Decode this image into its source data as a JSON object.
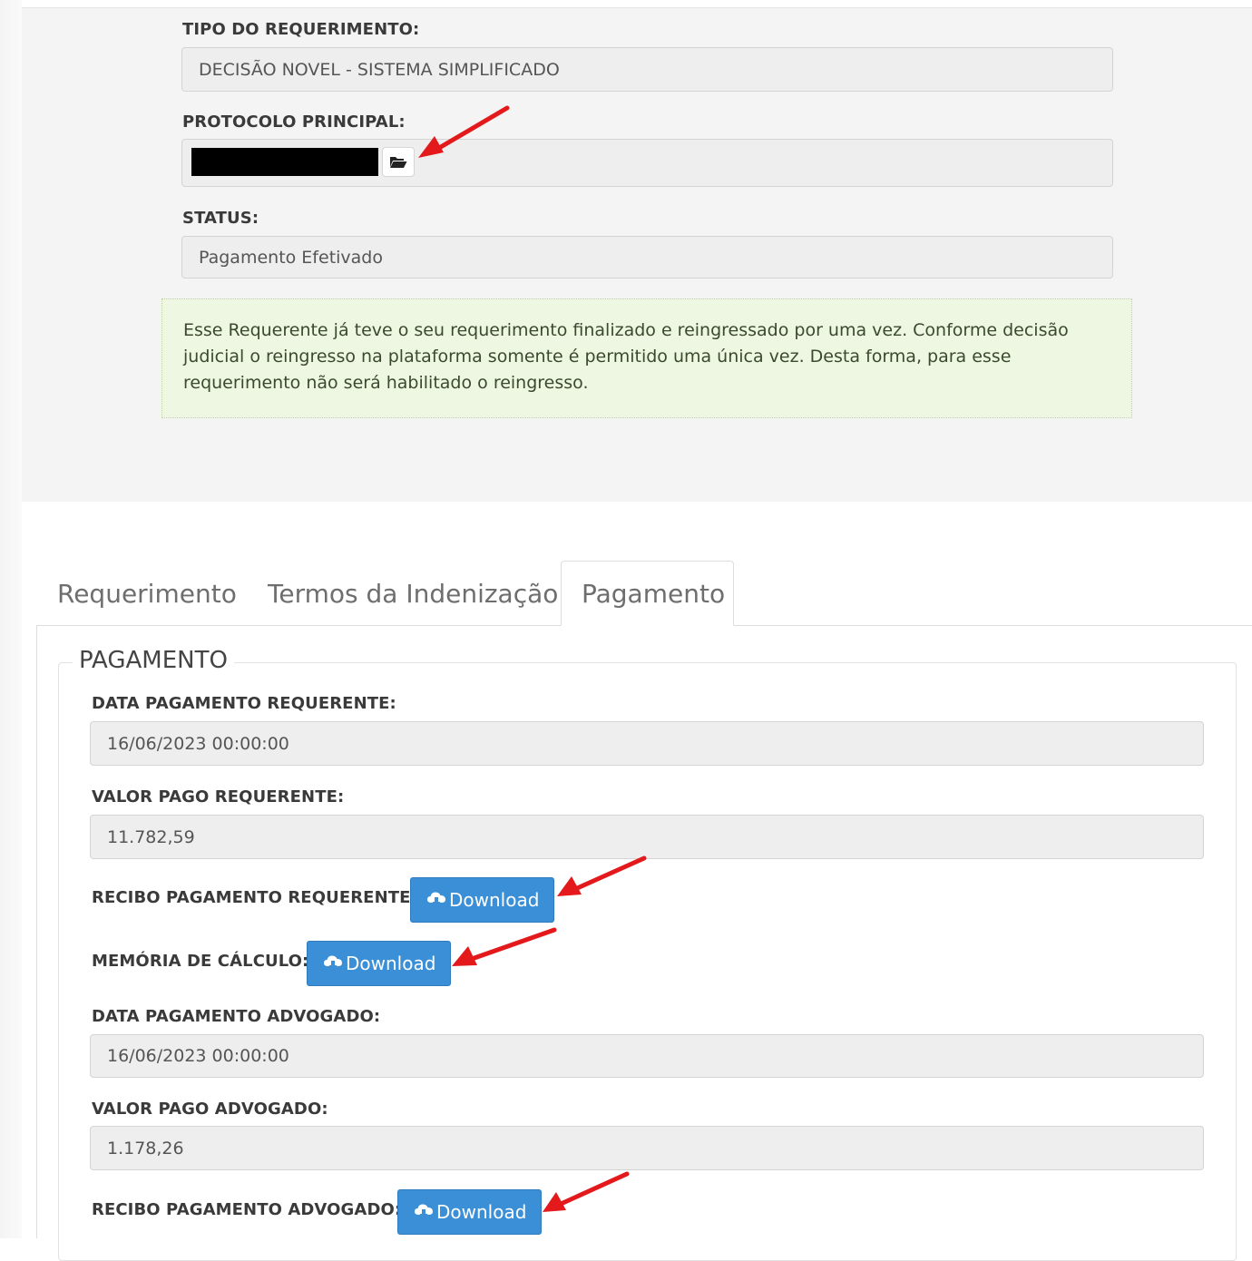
{
  "requerimento": {
    "tipo_label": "TIPO DO REQUERIMENTO:",
    "tipo_value": "DECISÃO NOVEL - SISTEMA SIMPLIFICADO",
    "protocolo_label": "PROTOCOLO PRINCIPAL:",
    "status_label": "STATUS:",
    "status_value": "Pagamento Efetivado",
    "alert_text": "Esse Requerente já teve o seu requerimento finalizado e reingressado por uma vez. Conforme decisão judicial o reingresso na plataforma somente é permitido uma única vez. Desta forma, para esse requerimento não será habilitado o reingresso."
  },
  "tabs": [
    {
      "label": "Requerimento",
      "active": false
    },
    {
      "label": "Termos da Indenização",
      "active": false
    },
    {
      "label": "Pagamento",
      "active": true
    }
  ],
  "pagamento": {
    "legend": "PAGAMENTO",
    "data_requerente_label": "DATA PAGAMENTO REQUERENTE:",
    "data_requerente_value": "16/06/2023 00:00:00",
    "valor_requerente_label": "VALOR PAGO REQUERENTE:",
    "valor_requerente_value": "11.782,59",
    "recibo_requerente_label": "RECIBO PAGAMENTO REQUERENTE:",
    "memoria_label": "MEMÓRIA DE CÁLCULO:",
    "data_advogado_label": "DATA PAGAMENTO ADVOGADO:",
    "data_advogado_value": "16/06/2023 00:00:00",
    "valor_advogado_label": "VALOR PAGO ADVOGADO:",
    "valor_advogado_value": "1.178,26",
    "recibo_advogado_label": "RECIBO PAGAMENTO ADVOGADO:",
    "download_label": "Download"
  },
  "icons": {
    "folder": "folder-open-icon",
    "download": "cloud-download-icon",
    "annotation": "red-arrow-icon"
  },
  "colors": {
    "button": "#3a8fd6",
    "alert_bg": "#eef7e1",
    "field_bg": "#eeeeee",
    "annotation_arrow": "#e3191b"
  }
}
